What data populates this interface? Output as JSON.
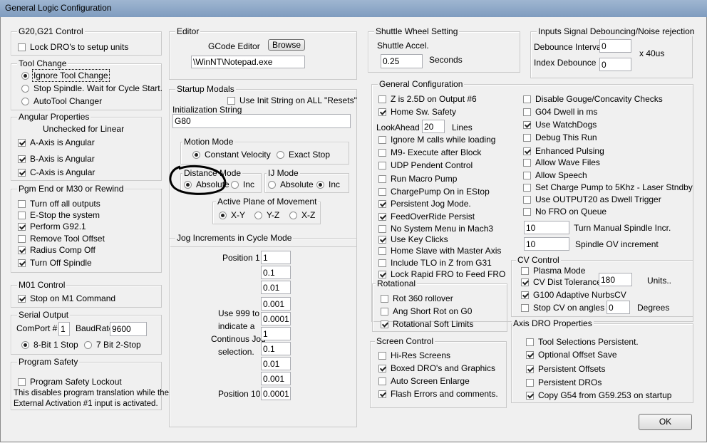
{
  "window": {
    "title": "General Logic Configuration",
    "ok_label": "OK"
  },
  "g20_g21": {
    "title": "G20,G21 Control",
    "lock_dros": {
      "label": "Lock DRO's to setup units",
      "checked": false
    }
  },
  "tool_change": {
    "title": "Tool Change",
    "options": [
      {
        "label": "Ignore Tool Change",
        "selected": true
      },
      {
        "label": "Stop Spindle. Wait for Cycle Start.",
        "selected": false
      },
      {
        "label": "AutoTool Changer",
        "selected": false
      }
    ]
  },
  "angular": {
    "title": "Angular Properties",
    "note": "Unchecked for Linear",
    "items": [
      {
        "label": "A-Axis is Angular",
        "checked": true
      },
      {
        "label": "B-Axis is Angular",
        "checked": true
      },
      {
        "label": "C-Axis is Angular",
        "checked": true
      }
    ]
  },
  "pgm_end": {
    "title": "Pgm End or M30 or Rewind",
    "items": [
      {
        "label": "Turn off all outputs",
        "checked": false
      },
      {
        "label": "E-Stop the system",
        "checked": false
      },
      {
        "label": "Perform G92.1",
        "checked": true
      },
      {
        "label": "Remove Tool Offset",
        "checked": false
      },
      {
        "label": "Radius Comp Off",
        "checked": true
      },
      {
        "label": "Turn Off Spindle",
        "checked": true
      }
    ]
  },
  "m01": {
    "title": "M01 Control",
    "stop_m1": {
      "label": "Stop on M1 Command",
      "checked": true
    }
  },
  "serial": {
    "title": "Serial Output",
    "comport_label": "ComPort #",
    "comport_value": "1",
    "baud_label": "BaudRate",
    "baud_value": "9600",
    "bit8_label": "8-Bit 1 Stop",
    "bit7_label": "7 Bit 2-Stop",
    "bit8_selected": true
  },
  "program_safety": {
    "title": "Program Safety",
    "lockout": {
      "label": "Program Safety Lockout",
      "checked": false
    },
    "note_line1": "This disables program translation while the",
    "note_line2": "External Activation #1 input is activated."
  },
  "editor": {
    "title": "Editor",
    "gcode_editor_label": "GCode Editor",
    "browse_label": "Browse",
    "path_value": "\\WinNT\\Notepad.exe"
  },
  "startup": {
    "title": "Startup Modals",
    "use_init": {
      "label": "Use Init String on ALL  \"Resets\"",
      "checked": false
    },
    "init_label": "Initialization String",
    "init_value": "G80",
    "motion_mode": {
      "title": "Motion Mode",
      "constant": "Constant Velocity",
      "exact": "Exact Stop",
      "constant_selected": true
    },
    "distance_mode": {
      "title": "Distance Mode",
      "absolute": "Absolute",
      "inc": "Inc",
      "absolute_selected": true
    },
    "ij_mode": {
      "title": "IJ Mode",
      "absolute": "Absolute",
      "inc": "Inc",
      "inc_selected": true
    },
    "plane": {
      "title": "Active Plane of Movement",
      "xy": "X-Y",
      "yz": "Y-Z",
      "xz": "X-Z",
      "xy_selected": true
    }
  },
  "jog": {
    "title": "Jog Increments in Cycle Mode",
    "position1_label": "Position 1",
    "position10_label": "Position 10",
    "note_lines": [
      "Use 999 to",
      "indicate a",
      "Continous Jog",
      "selection."
    ],
    "values": [
      "1",
      "0.1",
      "0.01",
      "0.001",
      "0.0001",
      "1",
      "0.1",
      "0.01",
      "0.001",
      "0.0001"
    ]
  },
  "shuttle": {
    "title": "Shuttle Wheel Setting",
    "accel_label": "Shuttle Accel.",
    "accel_value": "0.25",
    "seconds_label": "Seconds"
  },
  "debounce": {
    "title": "Inputs Signal Debouncing/Noise rejection",
    "interval_label": "Debounce Interval",
    "interval_value": "0",
    "index_label": "Index Debounce",
    "index_value": "0",
    "unit_label": "x 40us"
  },
  "general": {
    "title": "General Configuration",
    "z_on_output6": {
      "label": "Z is 2.5D on Output #6",
      "checked": false
    },
    "home_safety": {
      "label": "Home Sw. Safety",
      "checked": true
    },
    "lookahead_label": "LookAhead",
    "lookahead_value": "20",
    "lines_label": "Lines",
    "left_items": [
      {
        "label": "Ignore M calls while loading",
        "checked": false
      },
      {
        "label": "M9- Execute after Block",
        "checked": false
      },
      {
        "label": "UDP Pendent Control",
        "checked": false
      },
      {
        "label": "Run Macro Pump",
        "checked": false
      },
      {
        "label": "ChargePump On in EStop",
        "checked": false
      },
      {
        "label": "Persistent Jog Mode.",
        "checked": true
      },
      {
        "label": "FeedOverRide Persist",
        "checked": true
      },
      {
        "label": "No System Menu in Mach3",
        "checked": false
      },
      {
        "label": "Use Key Clicks",
        "checked": true
      },
      {
        "label": "Home Slave with Master Axis",
        "checked": false
      },
      {
        "label": "Include TLO in Z from G31",
        "checked": false
      },
      {
        "label": "Lock Rapid FRO to Feed FRO",
        "checked": true
      }
    ],
    "right_items": [
      {
        "label": "Disable Gouge/Concavity Checks",
        "checked": false
      },
      {
        "label": "G04 Dwell in ms",
        "checked": false
      },
      {
        "label": "Use WatchDogs",
        "checked": true
      },
      {
        "label": "Debug This Run",
        "checked": false
      },
      {
        "label": "Enhanced Pulsing",
        "checked": true
      },
      {
        "label": "Allow Wave Files",
        "checked": false
      },
      {
        "label": "Allow Speech",
        "checked": false
      },
      {
        "label": "Set Charge Pump to 5Khz  - Laser Stndby",
        "checked": false
      },
      {
        "label": "Use OUTPUT20 as Dwell Trigger",
        "checked": false
      },
      {
        "label": "No FRO on Queue",
        "checked": false
      }
    ],
    "spindle_incr_value": "10",
    "spindle_incr_label": "Turn Manual Spindle Incr.",
    "spindle_ov_value": "10",
    "spindle_ov_label": "Spindle OV increment"
  },
  "rotational": {
    "title": "Rotational",
    "items": [
      {
        "label": "Rot 360 rollover",
        "checked": false
      },
      {
        "label": "Ang Short Rot on G0",
        "checked": false
      },
      {
        "label": "Rotational Soft Limits",
        "checked": true
      }
    ]
  },
  "cv_control": {
    "title": "CV Control",
    "plasma": {
      "label": "Plasma Mode",
      "checked": false
    },
    "tolerance": {
      "label": "CV Dist Tolerance",
      "checked": true,
      "value": "180",
      "unit": "Units.."
    },
    "g100": {
      "label": "G100 Adaptive NurbsCV",
      "checked": true
    },
    "stop_cv": {
      "label": "Stop CV on angles >",
      "checked": false,
      "value": "0",
      "unit": "Degrees"
    }
  },
  "screen": {
    "title": "Screen Control",
    "items": [
      {
        "label": "Hi-Res Screens",
        "checked": false
      },
      {
        "label": "Boxed DRO's and Graphics",
        "checked": true
      },
      {
        "label": "Auto Screen Enlarge",
        "checked": false
      },
      {
        "label": "Flash Errors and comments.",
        "checked": true
      }
    ]
  },
  "axis_dro": {
    "title": "Axis DRO Properties",
    "items": [
      {
        "label": "Tool Selections Persistent.",
        "checked": false
      },
      {
        "label": "Optional Offset Save",
        "checked": true
      },
      {
        "label": "Persistent Offsets",
        "checked": true
      },
      {
        "label": "Persistent DROs",
        "checked": false
      },
      {
        "label": "Copy G54 from G59.253 on startup",
        "checked": true
      }
    ]
  }
}
